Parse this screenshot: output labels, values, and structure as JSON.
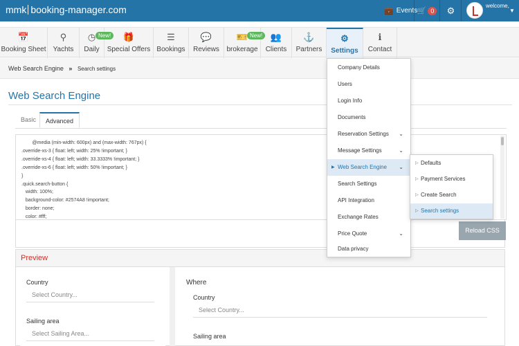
{
  "topbar": {
    "logo_prefix": "mmk",
    "logo_domain": "booking-manager.com",
    "events_label": "Events",
    "cart_count": "0",
    "welcome_text": "welcome,",
    "colors": {
      "bar": "#2574a8",
      "badge": "#d9534f"
    }
  },
  "nav": {
    "items": [
      {
        "label": "Booking Sheet",
        "icon": "calendar-icon"
      },
      {
        "label": "Yachts",
        "icon": "search-icon"
      },
      {
        "label": "Daily",
        "icon": "clock-icon",
        "badge": "New!"
      },
      {
        "label": "Special Offers",
        "icon": "gift-icon"
      },
      {
        "label": "Bookings",
        "icon": "list-icon"
      },
      {
        "label": "Reviews",
        "icon": "comment-icon"
      },
      {
        "label": "brokerage",
        "icon": "ticket-icon",
        "badge": "New!"
      },
      {
        "label": "Clients",
        "icon": "users-icon"
      },
      {
        "label": "Partners",
        "icon": "anchor-icon"
      },
      {
        "label": "Settings",
        "icon": "gears-icon",
        "active": true
      },
      {
        "label": "Contact",
        "icon": "info-icon"
      }
    ]
  },
  "breadcrumb": {
    "parent": "Web Search Engine",
    "separator": "»",
    "current": "Search settings"
  },
  "page": {
    "title": "Web Search Engine"
  },
  "tabs": {
    "basic": "Basic",
    "advanced": "Advanced"
  },
  "editor": {
    "lines": [
      "        @media (min-width: 600px) and (max-width: 767px) {",
      ".override-xs-3 { float: left; width: 25% !important; }",
      ".override-xs-4 { float: left; width: 33.3333% !important; }",
      ".override-xs-6 { float: left; width: 50% !important; }",
      "}",
      ".quick.search-button {",
      "   width: 100%;",
      "   background-color: #2574A8 !important;",
      "   border: none;",
      "   color: #fff;"
    ]
  },
  "reload_button": "Reload CSS",
  "preview": {
    "heading": "Preview",
    "left": {
      "country_label": "Country",
      "country_placeholder": "Select Country...",
      "sailing_label": "Sailing area",
      "sailing_placeholder": "Select Sailing Area..."
    },
    "right": {
      "where_label": "Where",
      "country_label": "Country",
      "country_placeholder": "Select Country...",
      "sailing_label": "Sailing area"
    }
  },
  "settings_menu": {
    "items": [
      {
        "label": "Company Details"
      },
      {
        "label": "Users"
      },
      {
        "label": "Login Info"
      },
      {
        "label": "Documents"
      },
      {
        "label": "Reservation Settings",
        "has_sub": true
      },
      {
        "label": "Message Settings",
        "has_sub": true
      },
      {
        "label": "Web Search Engine",
        "has_sub": true,
        "highlighted": true
      },
      {
        "label": "Search Settings"
      },
      {
        "label": "API Integration"
      },
      {
        "label": "Exchange Rates"
      },
      {
        "label": "Price Quote",
        "has_sub": true
      },
      {
        "label": "Data privacy"
      }
    ]
  },
  "submenu": {
    "items": [
      {
        "label": "Defaults"
      },
      {
        "label": "Payment Services"
      },
      {
        "label": "Create Search"
      },
      {
        "label": "Search settings",
        "highlighted": true
      }
    ]
  }
}
